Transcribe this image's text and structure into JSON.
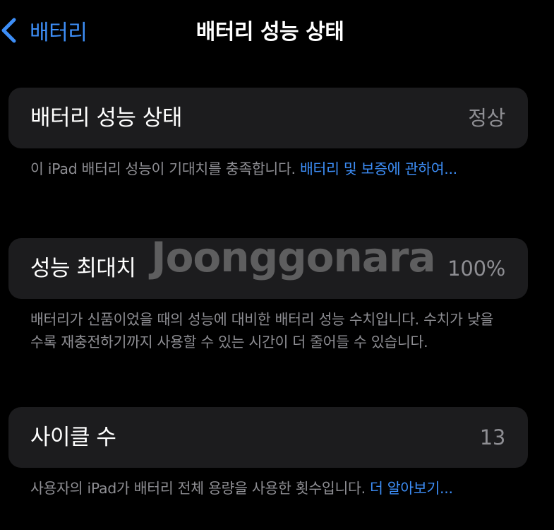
{
  "nav": {
    "back_label": "배터리",
    "title": "배터리 성능 상태"
  },
  "rows": [
    {
      "label": "배터리 성능 상태",
      "value": "정상",
      "footer_text": "이 iPad 배터리 성능이 기대치를 충족합니다. ",
      "footer_link": "배터리 및 보증에 관하여..."
    },
    {
      "label": "성능 최대치",
      "value": "100%",
      "footer_text": "배터리가 신품이었을 때의 성능에 대비한 배터리 성능 수치입니다. 수치가 낮을수록 재충전하기까지 사용할 수 있는 시간이 더 줄어들 수 있습니다."
    },
    {
      "label": "사이클 수",
      "value": "13",
      "footer_text": "사용자의 iPad가 배터리 전체 용량을 사용한 횟수입니다. ",
      "footer_link": "더 알아보기..."
    }
  ],
  "watermark": "Joonggonara",
  "colors": {
    "background": "#000000",
    "card": "#1c1c1e",
    "accent": "#3d8ef7",
    "secondary_text": "#8e8e93"
  },
  "icons": {
    "back": "chevron-left-icon"
  }
}
